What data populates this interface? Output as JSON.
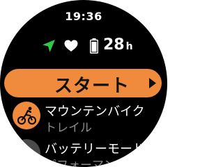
{
  "status": {
    "time": "19:36",
    "battery_value": "28",
    "battery_unit": "h",
    "icons": [
      "gps-arrow-icon",
      "heart-icon",
      "battery-icon"
    ]
  },
  "start": {
    "label": "スタート",
    "arrow_icon": "play-arrow-icon"
  },
  "list": {
    "items": [
      {
        "title": "マウンテンバイク",
        "subtitle": "トレイル",
        "icon": "mountain-bike-icon"
      },
      {
        "title": "バッテリーモード",
        "subtitle": "パフォーマンス",
        "icon": "battery-mode-icon"
      }
    ]
  },
  "colors": {
    "accent": "#f08a3c",
    "gps": "#2ec84a",
    "background": "#000000",
    "secondary_text": "#8a8a8a"
  }
}
